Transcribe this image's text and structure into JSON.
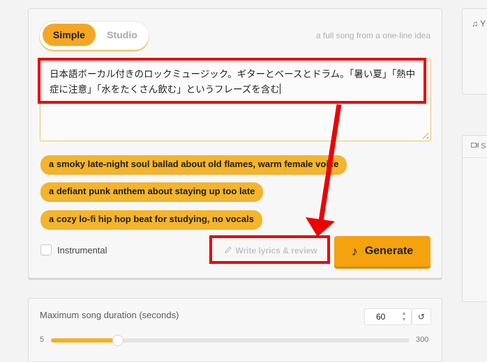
{
  "mode_toggle": {
    "simple_label": "Simple",
    "studio_label": "Studio",
    "selected": "Simple"
  },
  "hint": "a full song from a one-line idea",
  "prompt": {
    "value": "日本語ボーカル付きのロックミュージック。ギターとベースとドラム。「暑い夏」「熱中症に注意」「水をたくさん飲む」というフレーズを含む"
  },
  "suggestions": [
    "a smoky late-night soul ballad about old flames, warm female voice",
    "a defiant punk anthem about staying up too late",
    "a cozy lo-fi hip hop beat for studying, no vocals"
  ],
  "instrumental": {
    "label": "Instrumental",
    "checked": false
  },
  "write_lyrics": {
    "label": "Write lyrics & review",
    "icon": "pencil-icon"
  },
  "generate": {
    "label": "Generate",
    "icon": "music-note-icon"
  },
  "duration": {
    "label": "Maximum song duration (seconds)",
    "value": "60",
    "min": "5",
    "max": "300",
    "reset_icon": "reset-icon"
  },
  "side_panels": {
    "top_icon": "music-note-icon",
    "top_label_fragment": "Y",
    "bottom_icon": "video-icon",
    "bottom_label_fragment": "S"
  },
  "colors": {
    "accent": "#f5a623",
    "chip": "#f5b52a",
    "annotation_red": "#ee0000"
  }
}
